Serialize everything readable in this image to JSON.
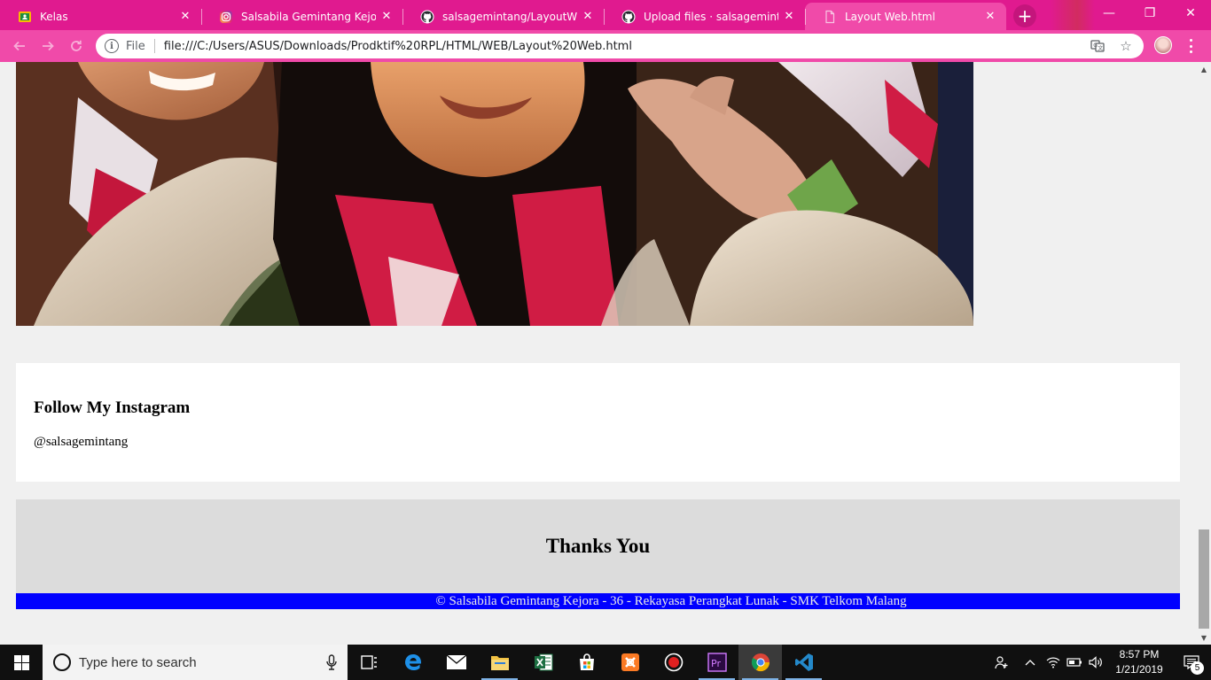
{
  "browser": {
    "tabs": [
      {
        "title": "Kelas",
        "favicon": "google-classroom-icon",
        "active": false
      },
      {
        "title": "Salsabila Gemintang Kejora (@",
        "favicon": "instagram-icon",
        "active": false
      },
      {
        "title": "salsagemintang/LayoutWebPr",
        "favicon": "github-icon",
        "active": false
      },
      {
        "title": "Upload files · salsagemintang/L",
        "favicon": "github-icon",
        "active": false
      },
      {
        "title": "Layout Web.html",
        "favicon": "file-icon",
        "active": true
      }
    ],
    "new_tab": "+",
    "window_controls": {
      "minimize": "—",
      "restore": "❐",
      "close": "✕"
    },
    "address": {
      "security_label": "File",
      "url": "file:///C:/Users/ASUS/Downloads/Prodktif%20RPL/HTML/WEB/Layout%20Web.html"
    },
    "theme_color": "#e01a8f",
    "toolbar_color": "#f04aa9"
  },
  "page": {
    "instagram_heading": "Follow My Instagram",
    "instagram_handle": "@salsagemintang",
    "thanks_heading": "Thanks You",
    "copyright": "© Salsabila Gemintang Kejora - 36 - Rekayasa Perangkat Lunak - SMK Telkom Malang",
    "copyright_bg": "#0000ff"
  },
  "taskbar": {
    "search_placeholder": "Type here to search",
    "apps": [
      "task-view-icon",
      "edge-icon",
      "mail-icon",
      "file-explorer-icon",
      "excel-icon",
      "store-icon",
      "xampp-icon",
      "record-icon",
      "premiere-icon",
      "chrome-icon",
      "vscode-icon"
    ],
    "clock_time": "8:57 PM",
    "clock_date": "1/21/2019",
    "notification_count": "5"
  }
}
